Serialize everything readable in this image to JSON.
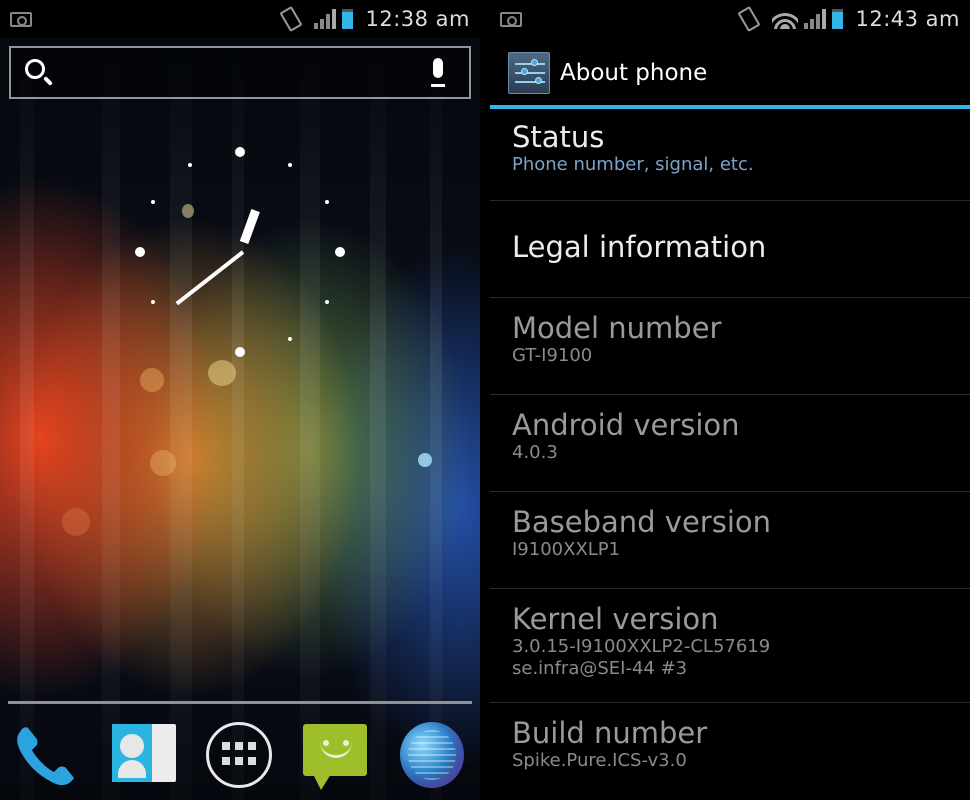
{
  "home_screen": {
    "status_bar": {
      "time": "12:38 am",
      "icons": [
        "screenshot-icon",
        "vibrate-icon",
        "signal-icon",
        "battery-icon"
      ],
      "battery_color": "#33b5e5"
    },
    "search_bar": {
      "placeholder": "",
      "search_icon": "search-icon",
      "voice_icon": "microphone-icon"
    },
    "clock_widget": {
      "type": "analog",
      "displayed_time": "12:38"
    },
    "dock": {
      "apps": [
        {
          "name": "Phone",
          "icon": "phone-icon"
        },
        {
          "name": "People",
          "icon": "contacts-icon"
        },
        {
          "name": "All apps",
          "icon": "app-drawer-icon"
        },
        {
          "name": "Messaging",
          "icon": "messaging-icon"
        },
        {
          "name": "Browser",
          "icon": "globe-icon"
        }
      ]
    }
  },
  "settings_screen": {
    "status_bar": {
      "time": "12:43 am",
      "icons": [
        "screenshot-icon",
        "vibrate-icon",
        "wifi-icon",
        "signal-icon",
        "battery-icon"
      ],
      "battery_color": "#33b5e5"
    },
    "action_bar": {
      "icon": "settings-sliders-icon",
      "title": "About phone",
      "accent_color": "#33b5e5"
    },
    "items": [
      {
        "title": "Status",
        "summary": "Phone number, signal, etc.",
        "summary2": ""
      },
      {
        "title": "Legal information",
        "summary": "",
        "summary2": ""
      },
      {
        "title": "Model number",
        "summary": "GT-I9100",
        "summary2": ""
      },
      {
        "title": "Android version",
        "summary": "4.0.3",
        "summary2": ""
      },
      {
        "title": "Baseband version",
        "summary": "I9100XXLP1",
        "summary2": ""
      },
      {
        "title": "Kernel version",
        "summary": "3.0.15-I9100XXLP2-CL57619",
        "summary2": "se.infra@SEI-44 #3"
      },
      {
        "title": "Build number",
        "summary": "Spike.Pure.ICS-v3.0",
        "summary2": ""
      }
    ]
  }
}
